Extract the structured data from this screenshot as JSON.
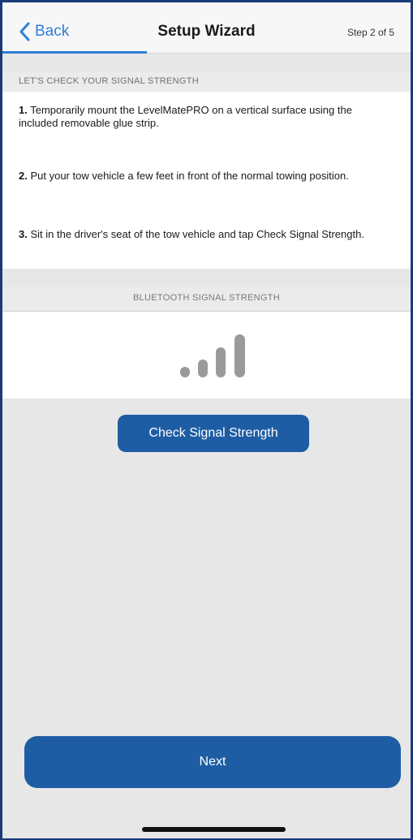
{
  "navbar": {
    "back_label": "Back",
    "title": "Setup Wizard",
    "step": "Step 2 of 5",
    "accent_color": "#2f7fd6"
  },
  "section": {
    "header": "LET'S CHECK YOUR SIGNAL STRENGTH"
  },
  "instructions": [
    {
      "number": "1.",
      "text": "Temporarily mount the LevelMatePRO on a vertical surface using the included removable glue strip."
    },
    {
      "number": "2.",
      "text": "Put your tow vehicle a few feet in front of the normal towing position."
    },
    {
      "number": "3.",
      "text": "Sit in the driver's seat of the tow vehicle and tap Check Signal Strength."
    }
  ],
  "bluetooth": {
    "header": "BLUETOOTH SIGNAL STRENGTH",
    "icon": "signal-bars-icon",
    "bars_total": 4,
    "bars_active": 4,
    "bar_color": "#9a9a9a"
  },
  "buttons": {
    "check_signal": "Check Signal Strength",
    "next": "Next",
    "button_color": "#1e5da3"
  }
}
